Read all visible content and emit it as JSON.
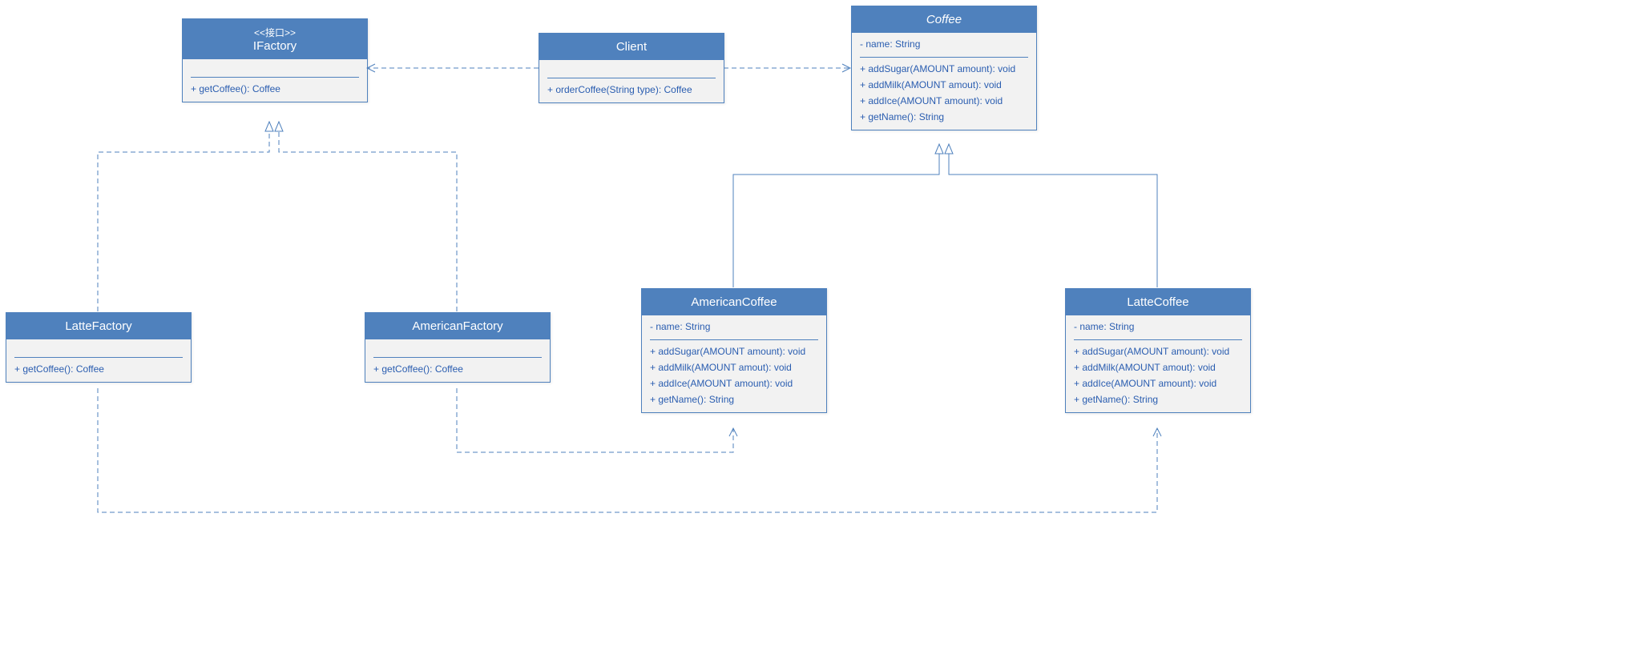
{
  "classes": {
    "ifactory": {
      "stereotype": "<<接口>>",
      "name": "IFactory",
      "methods": [
        "+ getCoffee(): Coffee"
      ]
    },
    "client": {
      "name": "Client",
      "methods": [
        "+ orderCoffee(String type): Coffee"
      ]
    },
    "coffee": {
      "name": "Coffee",
      "attrs": [
        "- name: String"
      ],
      "methods": [
        "+ addSugar(AMOUNT amount): void",
        "+ addMilk(AMOUNT amout): void",
        "+ addIce(AMOUNT amount): void",
        "+ getName(): String"
      ]
    },
    "lattefactory": {
      "name": "LatteFactory",
      "methods": [
        "+ getCoffee(): Coffee"
      ]
    },
    "americanfactory": {
      "name": "AmericanFactory",
      "methods": [
        "+ getCoffee(): Coffee"
      ]
    },
    "americancoffee": {
      "name": "AmericanCoffee",
      "attrs": [
        "- name: String"
      ],
      "methods": [
        "+ addSugar(AMOUNT amount): void",
        "+ addMilk(AMOUNT amout): void",
        "+ addIce(AMOUNT amount): void",
        "+ getName(): String"
      ]
    },
    "lattecoffee": {
      "name": "LatteCoffee",
      "attrs": [
        "- name: String"
      ],
      "methods": [
        "+ addSugar(AMOUNT amount): void",
        "+ addMilk(AMOUNT amout): void",
        "+ addIce(AMOUNT amount): void",
        "+ getName(): String"
      ]
    }
  },
  "colors": {
    "primary": "#4f81bd",
    "line": "#4f81bd",
    "text": "#2a5db0"
  }
}
